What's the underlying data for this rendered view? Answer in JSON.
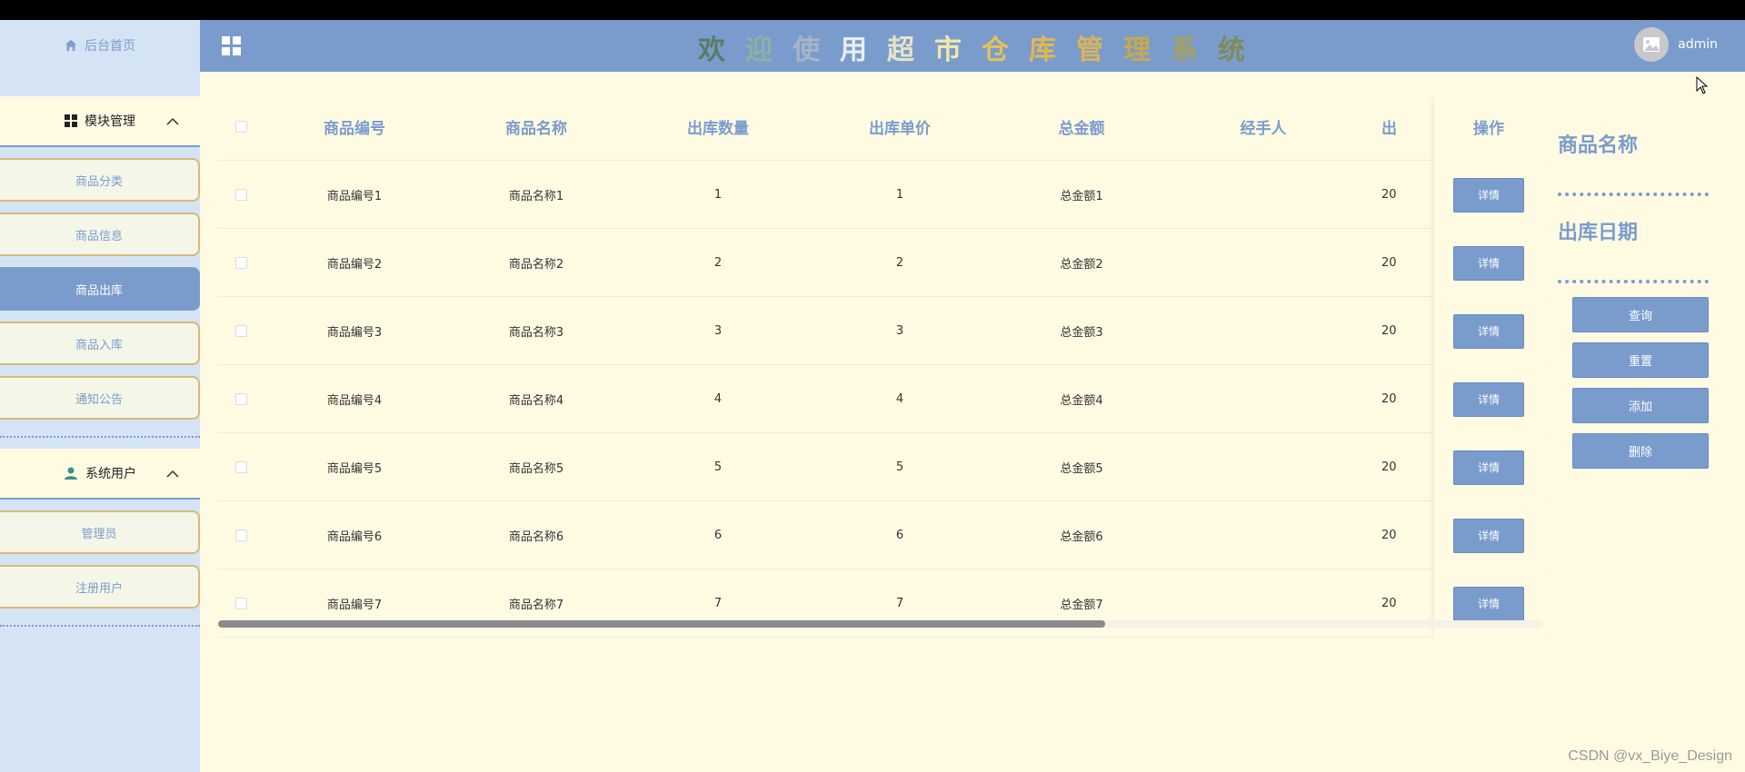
{
  "sidebar": {
    "home_label": "后台首页",
    "group1_label": "模块管理",
    "group1_items": [
      {
        "label": "商品分类"
      },
      {
        "label": "商品信息"
      },
      {
        "label": "商品出库"
      },
      {
        "label": "商品入库"
      },
      {
        "label": "通知公告"
      }
    ],
    "active_index": 2,
    "group2_label": "系统用户",
    "group2_items": [
      {
        "label": "管理员"
      },
      {
        "label": "注册用户"
      }
    ]
  },
  "header": {
    "title_chars": [
      "欢",
      "迎",
      "使",
      "用",
      "超",
      "市",
      "仓",
      "库",
      "管",
      "理",
      "系",
      "统"
    ],
    "title_colors": [
      "#5b7a66",
      "#8fb0a0",
      "#a7b5c4",
      "#e9eef4",
      "#e6e4c8",
      "#f3e9a8",
      "#e4c15a",
      "#e2b84e",
      "#d9b45c",
      "#c7a94c",
      "#a6a15a",
      "#7f8a5a"
    ],
    "username": "admin"
  },
  "table": {
    "headers": [
      "商品编号",
      "商品名称",
      "出库数量",
      "出库单价",
      "总金额",
      "经手人",
      "出"
    ],
    "op_header": "操作",
    "detail_label": "详情",
    "rows": [
      [
        "商品编号1",
        "商品名称1",
        "1",
        "1",
        "总金额1",
        "",
        "20"
      ],
      [
        "商品编号2",
        "商品名称2",
        "2",
        "2",
        "总金额2",
        "",
        "20"
      ],
      [
        "商品编号3",
        "商品名称3",
        "3",
        "3",
        "总金额3",
        "",
        "20"
      ],
      [
        "商品编号4",
        "商品名称4",
        "4",
        "4",
        "总金额4",
        "",
        "20"
      ],
      [
        "商品编号5",
        "商品名称5",
        "5",
        "5",
        "总金额5",
        "",
        "20"
      ],
      [
        "商品编号6",
        "商品名称6",
        "6",
        "6",
        "总金额6",
        "",
        "20"
      ],
      [
        "商品编号7",
        "商品名称7",
        "7",
        "7",
        "总金额7",
        "",
        "20"
      ]
    ]
  },
  "search": {
    "label_name": "商品名称",
    "label_date": "出库日期",
    "btn_query": "查询",
    "btn_reset": "重置",
    "btn_add": "添加",
    "btn_delete": "删除"
  },
  "watermark": "CSDN @vx_Biye_Design",
  "colors": {
    "accent": "#7a9ccd",
    "background": "#fffbe3",
    "sidebar": "#d4e4f5",
    "border_gold": "#d9b97a"
  }
}
